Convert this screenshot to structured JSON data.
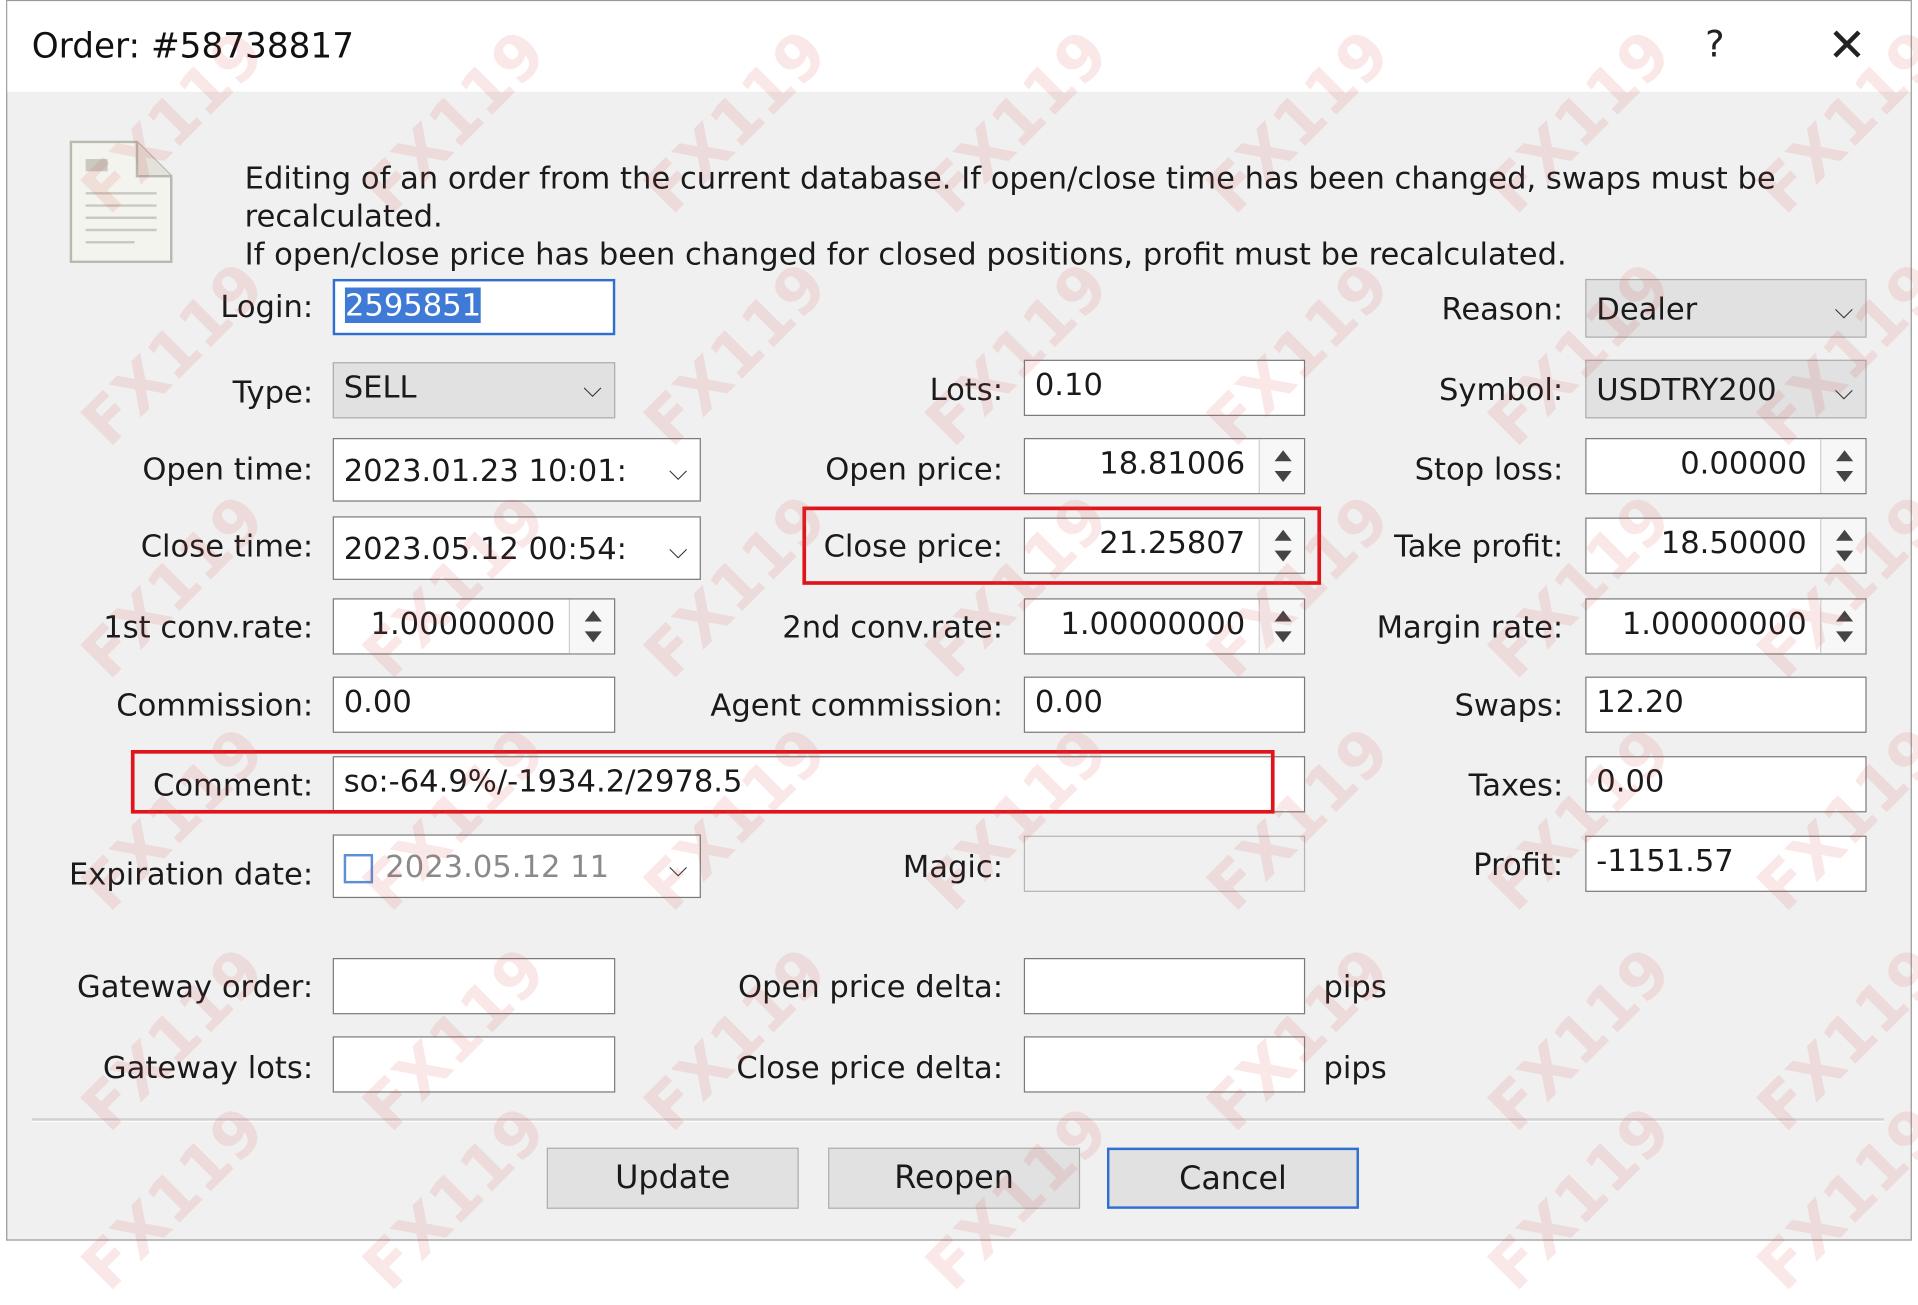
{
  "window": {
    "title": "Order: #58738817",
    "help_glyph": "?",
    "close_glyph": "✕"
  },
  "description": {
    "line1": "Editing of an order from the current database. If open/close time has been changed, swaps must be recalculated.",
    "line2": "If open/close price has been changed for closed positions, profit must be recalculated."
  },
  "labels": {
    "login": "Login:",
    "type": "Type:",
    "open_time": "Open time:",
    "close_time": "Close time:",
    "first_conv_rate": "1st conv.rate:",
    "commission": "Commission:",
    "comment": "Comment:",
    "expiration_date": "Expiration date:",
    "gateway_order": "Gateway order:",
    "gateway_lots": "Gateway lots:",
    "lots": "Lots:",
    "open_price": "Open price:",
    "close_price": "Close price:",
    "second_conv_rate": "2nd conv.rate:",
    "agent_commission": "Agent commission:",
    "magic": "Magic:",
    "open_price_delta": "Open price delta:",
    "close_price_delta": "Close price delta:",
    "reason": "Reason:",
    "symbol": "Symbol:",
    "stop_loss": "Stop loss:",
    "take_profit": "Take profit:",
    "margin_rate": "Margin rate:",
    "swaps": "Swaps:",
    "taxes": "Taxes:",
    "profit": "Profit:"
  },
  "values": {
    "login": "2595851",
    "type": "SELL",
    "open_time": "2023.01.23 10:01:",
    "close_time": "2023.05.12 00:54:",
    "first_conv_rate": "1.00000000",
    "commission": "0.00",
    "comment": "so:-64.9%/-1934.2/2978.5",
    "expiration_date": "2023.05.12 11",
    "gateway_order": "",
    "gateway_lots": "",
    "lots": "0.10",
    "open_price": "18.81006",
    "close_price": "21.25807",
    "second_conv_rate": "1.00000000",
    "agent_commission": "0.00",
    "magic": "",
    "open_price_delta": "",
    "close_price_delta": "",
    "reason": "Dealer",
    "symbol": "USDTRY200",
    "stop_loss": "0.00000",
    "take_profit": "18.50000",
    "margin_rate": "1.00000000",
    "swaps": "12.20",
    "taxes": "0.00",
    "profit": "-1151.57"
  },
  "units": {
    "open_price_delta": "pips",
    "close_price_delta": "pips"
  },
  "buttons": {
    "update": "Update",
    "reopen": "Reopen",
    "cancel": "Cancel"
  },
  "icons": {
    "chevron": "⌵",
    "document": "document-icon"
  },
  "watermark": "FX119",
  "colors": {
    "highlight": "#e0151c",
    "focus": "#2f6fd0",
    "selection": "#3f7bd6"
  }
}
